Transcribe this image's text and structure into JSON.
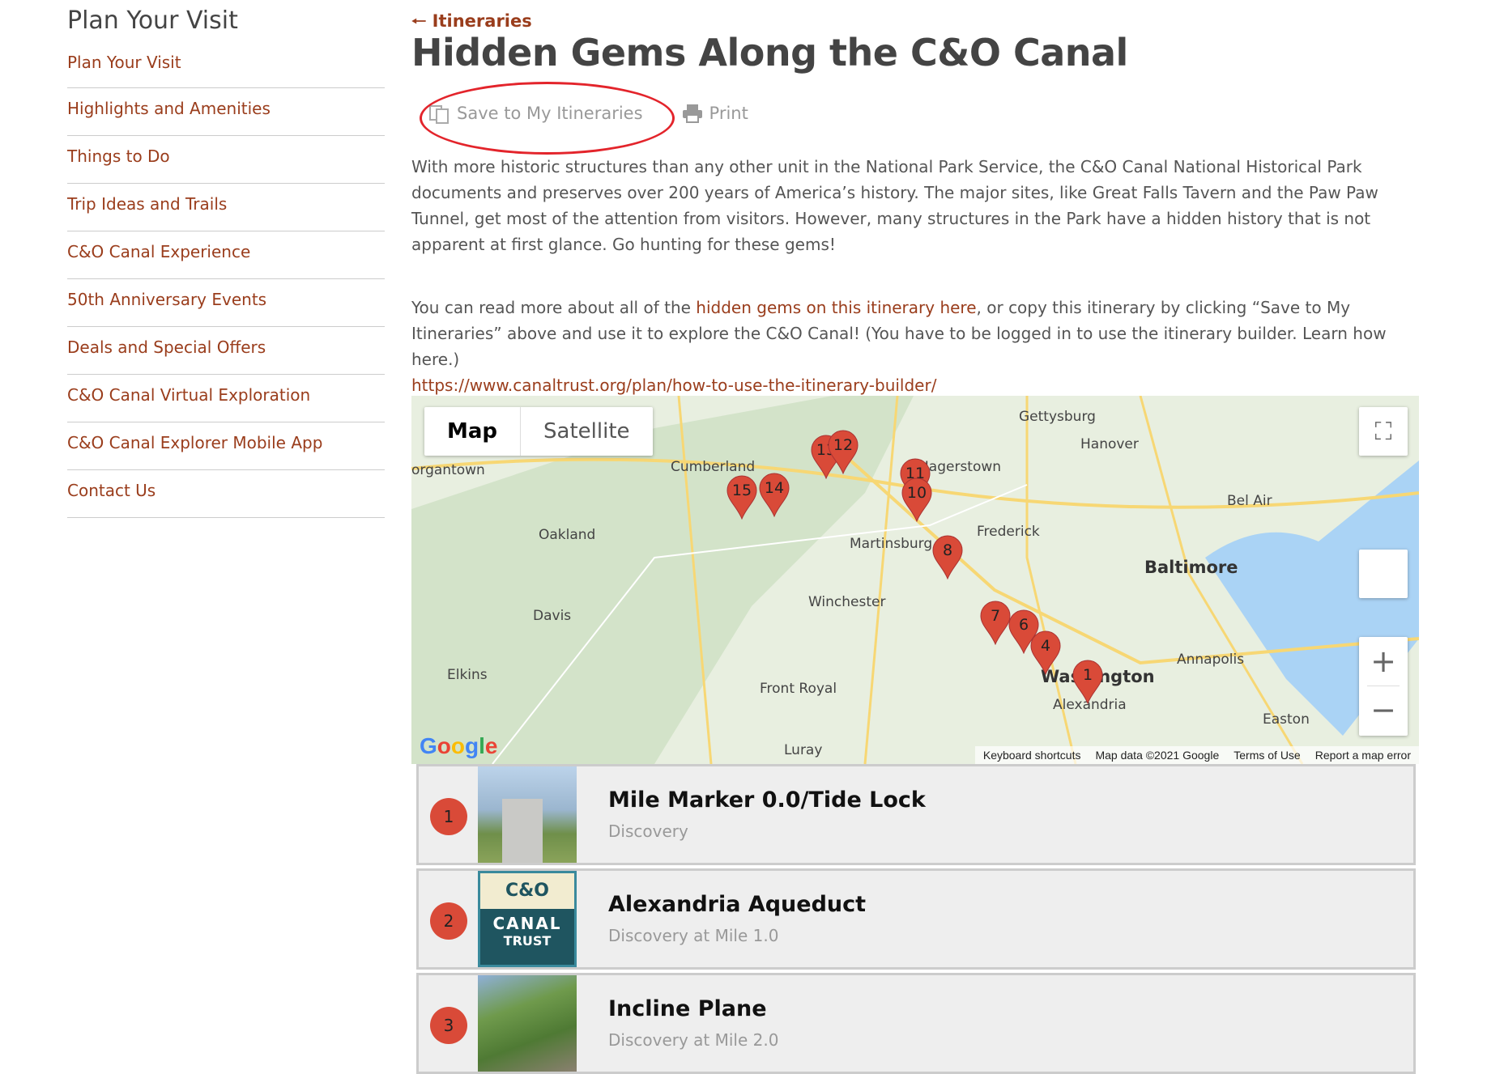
{
  "sidebar": {
    "title": "Plan Your Visit",
    "items": [
      "Plan Your Visit",
      "Highlights and Amenities",
      "Things to Do",
      "Trip Ideas and Trails",
      "C&O Canal Experience",
      "50th Anniversary Events",
      "Deals and Special Offers",
      "C&O Canal Virtual Exploration",
      "C&O Canal Explorer Mobile App",
      "Contact Us"
    ]
  },
  "header": {
    "back_label": "Itineraries",
    "title": "Hidden Gems Along the C&O Canal",
    "save_label": "Save to My Itineraries",
    "print_label": "Print"
  },
  "intro": "With more historic structures than any other unit in the National Park Service, the C&O Canal National Historical Park documents and preserves over 200 years of America’s history. The major sites, like Great Falls Tavern and the Paw Paw Tunnel, get most of the attention from visitors. However, many structures in the Park have a hidden history that is not apparent at first glance. Go hunting for these gems!",
  "para2": {
    "before": "You can read more about all of the ",
    "link": "hidden gems on this itinerary here",
    "after": ", or copy this itinerary by clicking “Save to My Itineraries” above and use it to explore the C&O Canal! (You have to be logged in to use the itinerary builder. Learn how here.) ",
    "url": "https://www.canaltrust.org/plan/how-to-use-the-itinerary-builder/"
  },
  "map": {
    "type_map": "Map",
    "type_satellite": "Satellite",
    "google": "Google",
    "attribution": [
      "Keyboard shortcuts",
      "Map data ©2021 Google",
      "Terms of Use",
      "Report a map error"
    ],
    "markers": [
      "15",
      "14",
      "13",
      "12",
      "11",
      "10",
      "8",
      "7",
      "6",
      "4",
      "1"
    ],
    "cities": [
      "Cumberland",
      "Hagerstown",
      "Frederick",
      "Martinsburg",
      "Baltimore",
      "Washington",
      "Alexandria",
      "Annapolis",
      "Winchester",
      "Front Royal",
      "Oakland",
      "Davis",
      "Elkins",
      "Gettysburg",
      "Hanover",
      "Bel Air",
      "Easton",
      "Luray",
      "organtown"
    ],
    "marker_color": "#d94a38"
  },
  "itinerary": [
    {
      "num": "1",
      "title": "Mile Marker 0.0/Tide Lock",
      "subtitle": "Discovery"
    },
    {
      "num": "2",
      "title": "Alexandria Aqueduct",
      "subtitle": "Discovery at Mile 1.0",
      "thumb_text": [
        "C&O",
        "CANAL",
        "TRUST"
      ]
    },
    {
      "num": "3",
      "title": "Incline Plane",
      "subtitle": "Discovery at Mile 2.0"
    }
  ],
  "colors": {
    "link": "#9a3d1c",
    "highlight_circle": "#e3242b"
  }
}
